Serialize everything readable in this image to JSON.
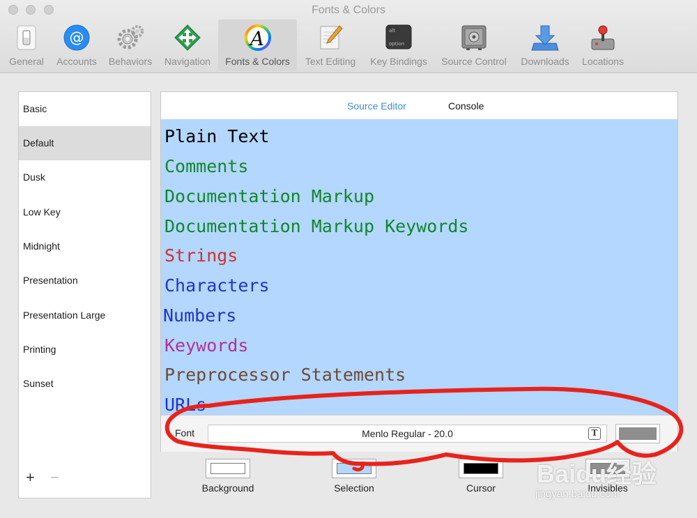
{
  "window": {
    "title": "Fonts & Colors"
  },
  "toolbar": {
    "items": [
      {
        "label": "General"
      },
      {
        "label": "Accounts"
      },
      {
        "label": "Behaviors"
      },
      {
        "label": "Navigation"
      },
      {
        "label": "Fonts & Colors"
      },
      {
        "label": "Text Editing"
      },
      {
        "label": "Key Bindings",
        "key_top": "alt",
        "key_bottom": "option"
      },
      {
        "label": "Source Control"
      },
      {
        "label": "Downloads"
      },
      {
        "label": "Locations"
      }
    ],
    "active": "Fonts & Colors"
  },
  "themes": {
    "items": [
      "Basic",
      "Default",
      "Dusk",
      "Low Key",
      "Midnight",
      "Presentation",
      "Presentation Large",
      "Printing",
      "Sunset"
    ],
    "selected": "Default",
    "add_label": "+",
    "remove_label": "−"
  },
  "tabs": {
    "source_editor": "Source Editor",
    "console": "Console",
    "active_color": "#3d8fd1"
  },
  "syntax_items": [
    {
      "label": "Plain Text",
      "color": "#000000"
    },
    {
      "label": "Comments",
      "color": "#13862c"
    },
    {
      "label": "Documentation Markup",
      "color": "#13862c"
    },
    {
      "label": "Documentation Markup Keywords",
      "color": "#13862c"
    },
    {
      "label": "Strings",
      "color": "#d12f2f"
    },
    {
      "label": "Characters",
      "color": "#2233c8"
    },
    {
      "label": "Numbers",
      "color": "#2233c8"
    },
    {
      "label": "Keywords",
      "color": "#b2329b"
    },
    {
      "label": "Preprocessor Statements",
      "color": "#6e4a35"
    },
    {
      "label": "URLs",
      "color": "#2233c8"
    }
  ],
  "preview": {
    "background": "#b3d7ff"
  },
  "font_settings": {
    "label": "Font",
    "value": "Menlo Regular - 20.0",
    "picker_glyph": "T",
    "color": "#8e8e8e"
  },
  "color_wells": {
    "background": {
      "label": "Background",
      "color": "#ffffff"
    },
    "selection": {
      "label": "Selection",
      "color": "#b3d7ff"
    },
    "cursor": {
      "label": "Cursor",
      "color": "#000000"
    },
    "invisibles": {
      "label": "Invisibles",
      "color": "#8e8e8e"
    }
  },
  "annotation": {
    "color": "#e8231c"
  },
  "watermark": {
    "text": "Baidu经验",
    "sub": "jingyan.baidu.com"
  }
}
